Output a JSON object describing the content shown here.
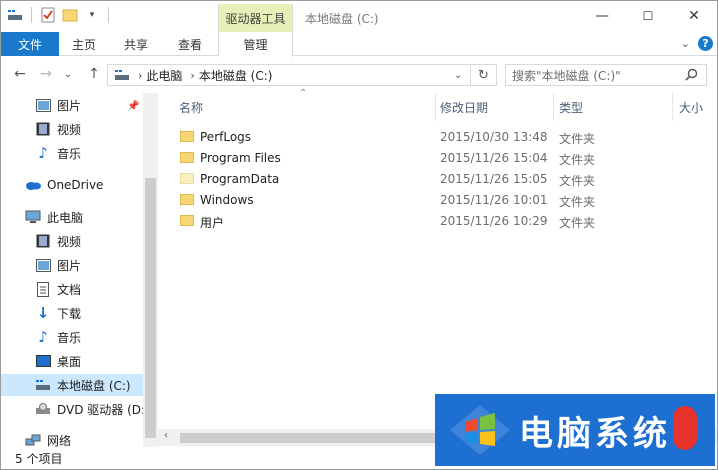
{
  "titlebar": {
    "context_tab": "驱动器工具",
    "title": "本地磁盘 (C:)",
    "minimize": "—",
    "maximize": "☐",
    "close": "✕"
  },
  "ribbon": {
    "tabs": [
      "文件",
      "主页",
      "共享",
      "查看",
      "管理"
    ],
    "help": "?"
  },
  "address": {
    "crumbs": [
      "此电脑",
      "本地磁盘 (C:)"
    ],
    "search_placeholder": "搜索\"本地磁盘 (C:)\""
  },
  "sidebar": {
    "items": [
      {
        "label": "图片",
        "icon": "pictures-icon"
      },
      {
        "label": "视频",
        "icon": "videos-icon"
      },
      {
        "label": "音乐",
        "icon": "music-icon"
      },
      {
        "label": "OneDrive",
        "icon": "onedrive-icon"
      },
      {
        "label": "此电脑",
        "icon": "this-pc-icon"
      },
      {
        "label": "视频",
        "icon": "videos-icon"
      },
      {
        "label": "图片",
        "icon": "pictures-icon"
      },
      {
        "label": "文档",
        "icon": "documents-icon"
      },
      {
        "label": "下载",
        "icon": "downloads-icon"
      },
      {
        "label": "音乐",
        "icon": "music-icon"
      },
      {
        "label": "桌面",
        "icon": "desktop-icon"
      },
      {
        "label": "本地磁盘 (C:)",
        "icon": "local-disk-icon"
      },
      {
        "label": "DVD 驱动器 (D:",
        "icon": "dvd-drive-icon"
      },
      {
        "label": "网络",
        "icon": "network-icon"
      }
    ]
  },
  "columns": {
    "name": "名称",
    "date": "修改日期",
    "type": "类型",
    "size": "大小"
  },
  "files": [
    {
      "name": "PerfLogs",
      "date": "2015/10/30 13:48",
      "type": "文件夹"
    },
    {
      "name": "Program Files",
      "date": "2015/11/26 15:04",
      "type": "文件夹"
    },
    {
      "name": "ProgramData",
      "date": "2015/11/26 15:05",
      "type": "文件夹"
    },
    {
      "name": "Windows",
      "date": "2015/11/26 10:01",
      "type": "文件夹"
    },
    {
      "name": "用户",
      "date": "2015/11/26 10:29",
      "type": "文件夹"
    }
  ],
  "status": {
    "count": "5 个项目"
  },
  "watermark": {
    "text": "电脑系统"
  },
  "colors": {
    "file_tab": "#1979ca",
    "context_tab": "#e8f0b8",
    "selected": "#cce8ff",
    "folder": "#f7d774",
    "watermark_bg": "#1e6fd2"
  }
}
